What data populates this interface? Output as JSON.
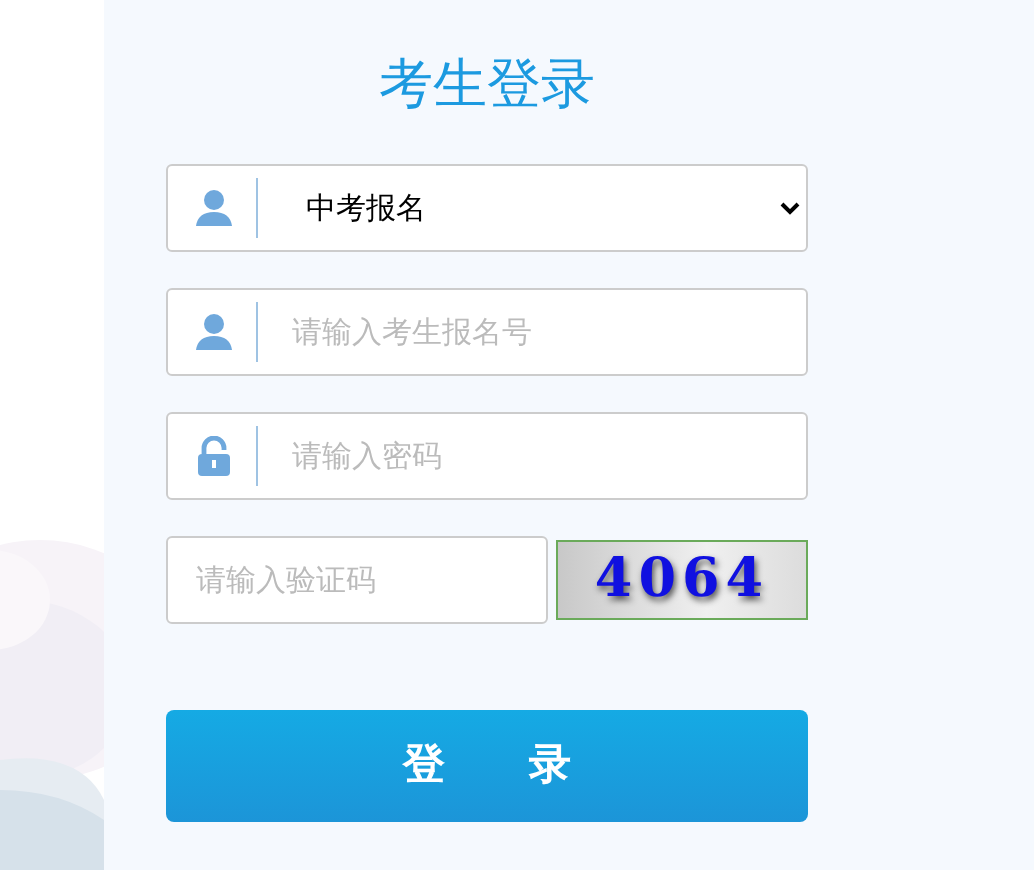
{
  "title": "考生登录",
  "fields": [
    {
      "kind": "select",
      "value": "中考报名"
    },
    {
      "kind": "account",
      "placeholder": "请输入考生报名号"
    },
    {
      "kind": "password",
      "placeholder": "请输入密码"
    }
  ],
  "captcha": {
    "placeholder": "请输入验证码",
    "code": "4064"
  },
  "submit": "登　　录"
}
